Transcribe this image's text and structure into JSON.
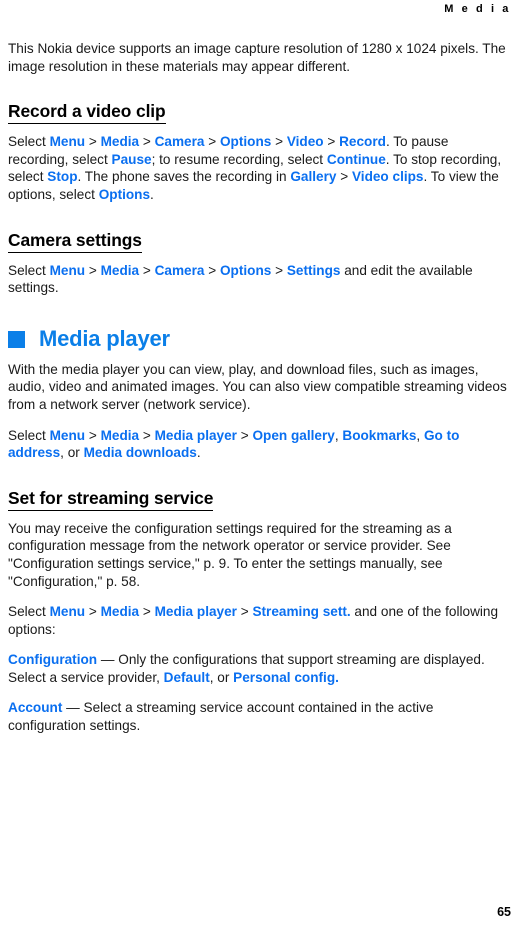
{
  "header": {
    "running_head": "M e d i a"
  },
  "footer": {
    "page_number": "65"
  },
  "colors": {
    "link_blue": "#0a6ff0",
    "chapter_blue": "#0b7fe8",
    "text_black": "#1a1a1a"
  },
  "content": {
    "intro_paragraph": "This Nokia device supports an image capture resolution of 1280 x 1024 pixels. The image resolution in these materials may appear different.",
    "section_record": {
      "heading": "Record a video clip",
      "p1": {
        "t1": "Select ",
        "l1": "Menu",
        "s1": " > ",
        "l2": "Media",
        "s2": " > ",
        "l3": "Camera",
        "s3": " > ",
        "l4": "Options",
        "s4": " > ",
        "l5": "Video",
        "s5": " > ",
        "l6": "Record",
        "t2": ". To pause recording, select ",
        "l7": "Pause",
        "t3": "; to resume recording, select ",
        "l8": "Continue",
        "t4": ". To stop recording, select ",
        "l9": "Stop",
        "t5": ". The phone saves the recording in ",
        "l10": "Gallery",
        "s6": " > ",
        "l11": "Video clips",
        "t6": ". To view the options, select ",
        "l12": "Options",
        "t7": "."
      }
    },
    "section_camera_settings": {
      "heading": "Camera settings",
      "p1": {
        "t1": "Select ",
        "l1": "Menu",
        "s1": " > ",
        "l2": "Media",
        "s2": " > ",
        "l3": "Camera",
        "s3": " > ",
        "l4": "Options",
        "s4": " > ",
        "l5": "Settings",
        "t2": " and edit the available settings."
      }
    },
    "chapter_media_player": {
      "title": "Media player",
      "bullet_icon": "square-bullet-icon",
      "p1": "With the media player you can view, play, and download files, such as images, audio, video and animated images. You can also view compatible streaming videos from a network server (network service).",
      "p2": {
        "t1": "Select ",
        "l1": "Menu",
        "s1": " > ",
        "l2": "Media",
        "s2": " > ",
        "l3": "Media player",
        "s3": " > ",
        "l4": "Open gallery",
        "t2": ", ",
        "l5": "Bookmarks",
        "t3": ", ",
        "l6": "Go to address",
        "t4": ", or ",
        "l7": "Media downloads",
        "t5": "."
      }
    },
    "section_streaming": {
      "heading": "Set for streaming service",
      "p1": "You may receive the configuration settings required for the streaming as a configuration message from the network operator or service provider. See \"Configuration settings service,\" p. 9. To enter the settings manually, see \"Configuration,\" p. 58.",
      "p2": {
        "t1": "Select ",
        "l1": "Menu",
        "s1": " > ",
        "l2": "Media",
        "s2": " > ",
        "l3": "Media player",
        "s3": " > ",
        "l4": "Streaming sett.",
        "t2": " and one of the following options:"
      },
      "p3": {
        "l1": "Configuration",
        "t1": " — Only the configurations that support streaming are displayed. Select a service provider, ",
        "l2": "Default",
        "t2": ", or ",
        "l3": "Personal config.",
        "t3": ""
      },
      "p4": {
        "l1": "Account",
        "t1": " — Select a streaming service account contained in the active configuration settings."
      }
    }
  }
}
